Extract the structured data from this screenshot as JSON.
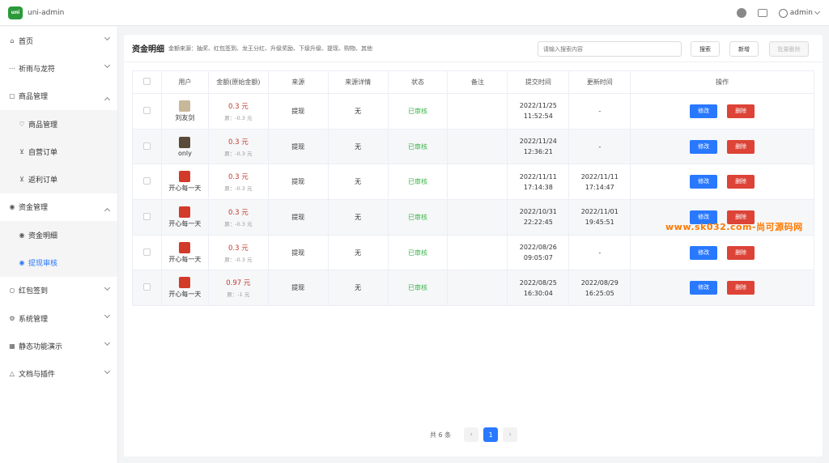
{
  "app": {
    "title": "uni-admin",
    "logo_text": "uni"
  },
  "topbar": {
    "user": "admin"
  },
  "sidebar": {
    "items": [
      {
        "label": "首页",
        "icon": "home-icon",
        "glyph": "⌂",
        "expanded": false
      },
      {
        "label": "祈雨与龙符",
        "icon": "more-icon",
        "glyph": "⋯",
        "expanded": false
      },
      {
        "label": "商品管理",
        "icon": "shop-icon",
        "glyph": "▢",
        "expanded": true,
        "children": [
          {
            "label": "商品管理",
            "icon": "heart-icon",
            "glyph": "♡"
          },
          {
            "label": "自营订单",
            "icon": "cart-icon",
            "glyph": "⊻"
          },
          {
            "label": "返利订单",
            "icon": "cart-icon",
            "glyph": "⊻"
          }
        ]
      },
      {
        "label": "资金管理",
        "icon": "eye-icon",
        "glyph": "◉",
        "expanded": true,
        "children": [
          {
            "label": "资金明细",
            "icon": "eye-icon",
            "glyph": "◉"
          },
          {
            "label": "提现审核",
            "icon": "eye-icon",
            "glyph": "◉",
            "active": true
          }
        ]
      },
      {
        "label": "红包签到",
        "icon": "circle-icon",
        "glyph": "○",
        "expanded": false
      },
      {
        "label": "系统管理",
        "icon": "gear-icon",
        "glyph": "⚙",
        "expanded": false
      },
      {
        "label": "静态功能演示",
        "icon": "grid-icon",
        "glyph": "▦",
        "expanded": false
      },
      {
        "label": "文档与插件",
        "icon": "bell-icon",
        "glyph": "△",
        "expanded": false
      }
    ]
  },
  "panel": {
    "title": "资金明细",
    "subtitle": "金额来源：抽奖、红包签到、龙王分红、升级奖励、下级升级、提现、购物、其他",
    "search_placeholder": "请输入搜索内容",
    "search_button": "搜索",
    "add_button": "新增",
    "batch_delete_button": "批量删除"
  },
  "table": {
    "columns": [
      "用户",
      "金额(原始金额)",
      "来源",
      "来源详情",
      "状态",
      "备注",
      "提交时间",
      "更新时间",
      "操作"
    ],
    "rows": [
      {
        "user": "刘友剑",
        "avatar_color": "#c8b89a",
        "amount": "0.3 元",
        "original": "原：-0.3 元",
        "source": "提现",
        "detail": "无",
        "status": "已审核",
        "note": "",
        "submit_date": "2022/11/25",
        "submit_time": "11:52:54",
        "update_date": "-",
        "update_time": ""
      },
      {
        "user": "only",
        "avatar_color": "#5a4a3a",
        "amount": "0.3 元",
        "original": "原：-0.3 元",
        "source": "提现",
        "detail": "无",
        "status": "已审核",
        "note": "",
        "submit_date": "2022/11/24",
        "submit_time": "12:36:21",
        "update_date": "-",
        "update_time": ""
      },
      {
        "user": "开心每一天",
        "avatar_color": "#d23a2a",
        "amount": "0.3 元",
        "original": "原：-0.3 元",
        "source": "提现",
        "detail": "无",
        "status": "已审核",
        "note": "",
        "submit_date": "2022/11/11",
        "submit_time": "17:14:38",
        "update_date": "2022/11/11",
        "update_time": "17:14:47"
      },
      {
        "user": "开心每一天",
        "avatar_color": "#d23a2a",
        "amount": "0.3 元",
        "original": "原：-0.3 元",
        "source": "提现",
        "detail": "无",
        "status": "已审核",
        "note": "",
        "submit_date": "2022/10/31",
        "submit_time": "22:22:45",
        "update_date": "2022/11/01",
        "update_time": "19:45:51"
      },
      {
        "user": "开心每一天",
        "avatar_color": "#d23a2a",
        "amount": "0.3 元",
        "original": "原：-0.3 元",
        "source": "提现",
        "detail": "无",
        "status": "已审核",
        "note": "",
        "submit_date": "2022/08/26",
        "submit_time": "09:05:07",
        "update_date": "-",
        "update_time": ""
      },
      {
        "user": "开心每一天",
        "avatar_color": "#d23a2a",
        "amount": "0.97 元",
        "original": "原：-1 元",
        "source": "提现",
        "detail": "无",
        "status": "已审核",
        "note": "",
        "submit_date": "2022/08/25",
        "submit_time": "16:30:04",
        "update_date": "2022/08/29",
        "update_time": "16:25:05"
      }
    ],
    "edit_label": "修改",
    "delete_label": "删除"
  },
  "pagination": {
    "total_text": "共 6 条",
    "current": "1",
    "prev": "‹",
    "next": "›"
  },
  "watermark": "www.sk032.com-尚可源码网",
  "colors": {
    "primary": "#2979ff",
    "danger": "#dd4337",
    "success": "#3bb54a",
    "amount": "#c0392b",
    "brand": "#2b9939"
  }
}
